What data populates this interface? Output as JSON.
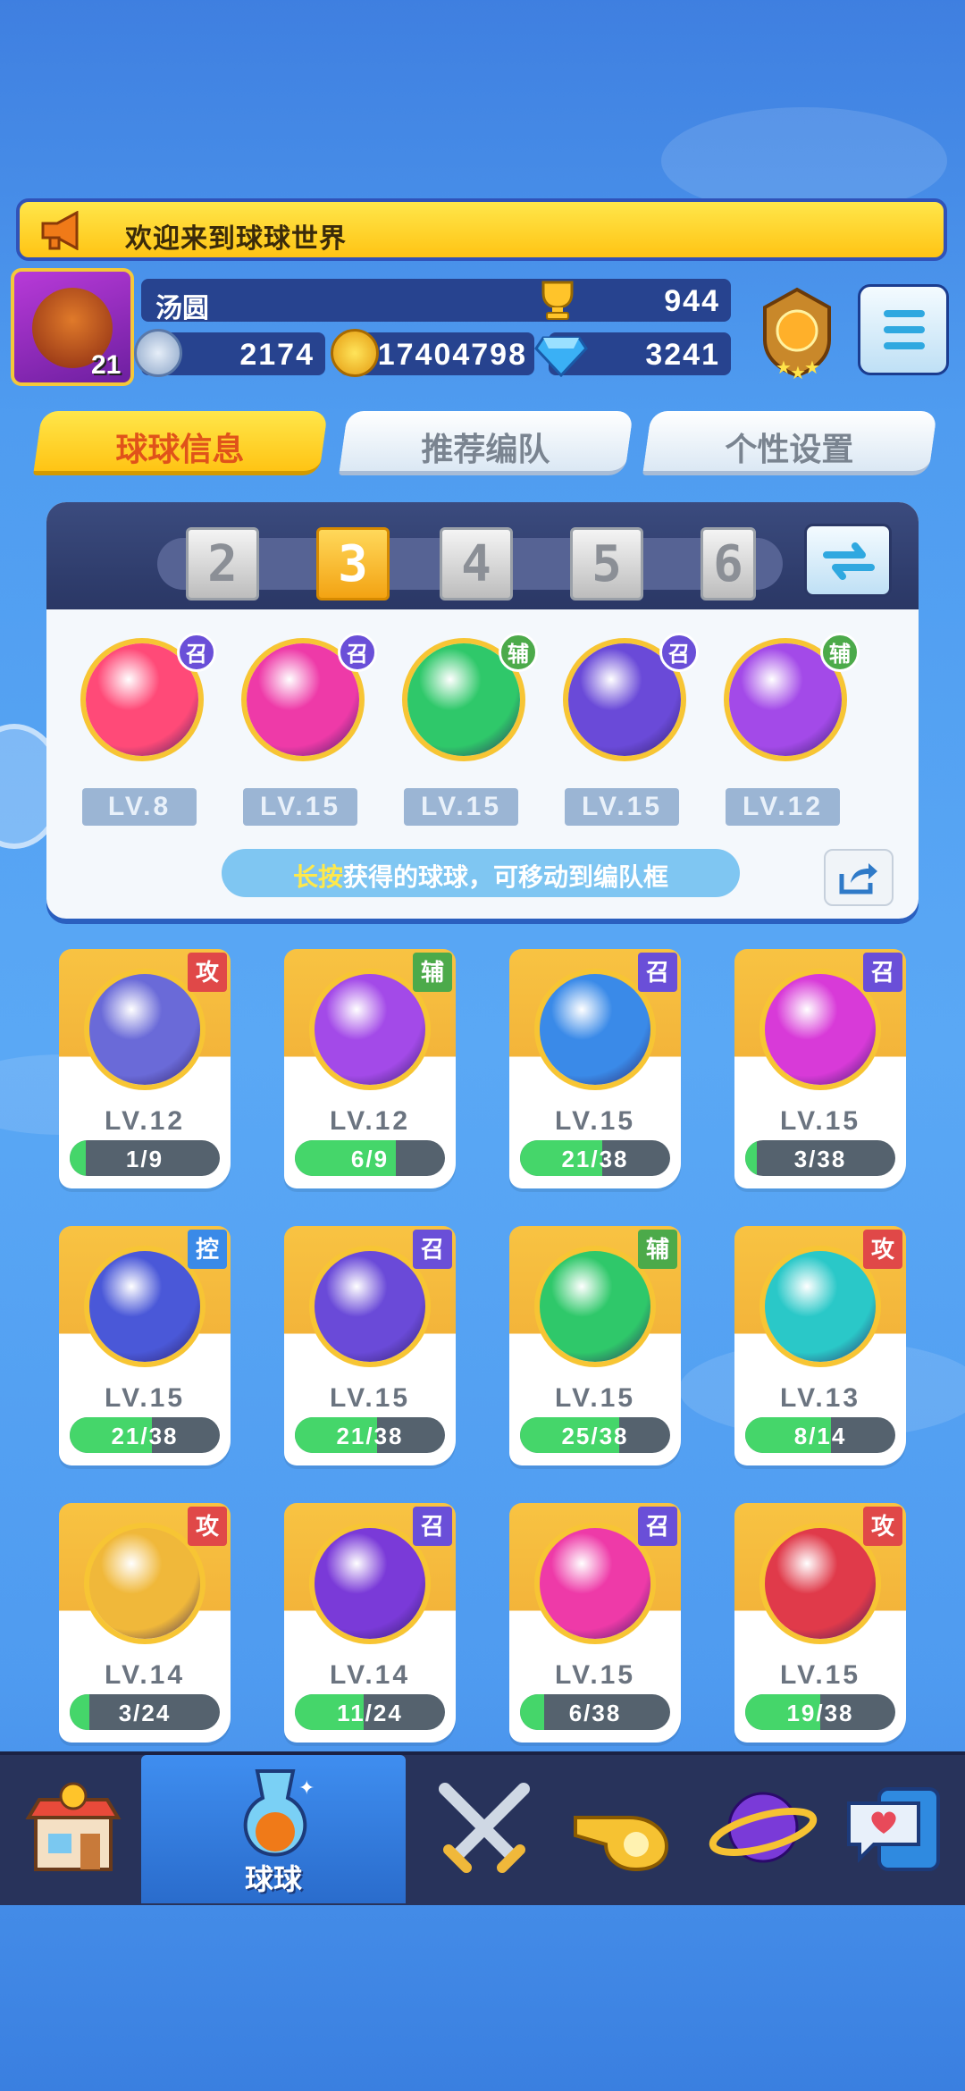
{
  "banner": {
    "text": "欢迎来到球球世界"
  },
  "player": {
    "name": "汤圆",
    "level": "21",
    "trophies": "944",
    "energy": "2174",
    "coins": "17404798",
    "gems": "3241"
  },
  "tabs": [
    {
      "label": "球球信息",
      "active": true
    },
    {
      "label": "推荐编队",
      "active": false
    },
    {
      "label": "个性设置",
      "active": false
    }
  ],
  "team": {
    "slots": [
      "2",
      "3",
      "4",
      "5",
      "6"
    ],
    "active_slot": "3",
    "balls": [
      {
        "level": "LV.8",
        "tag": "召",
        "color": "#ff4a78",
        "tag_color": "#6a4fd8"
      },
      {
        "level": "LV.15",
        "tag": "召",
        "color": "#ee3aa8",
        "tag_color": "#6a4fd8"
      },
      {
        "level": "LV.15",
        "tag": "辅",
        "color": "#2fc86a",
        "tag_color": "#4caa4a"
      },
      {
        "level": "LV.15",
        "tag": "召",
        "color": "#6a4ad8",
        "tag_color": "#6a4fd8"
      },
      {
        "level": "LV.12",
        "tag": "辅",
        "color": "#a34ae8",
        "tag_color": "#4caa4a"
      }
    ],
    "hint_key": "长按",
    "hint_rest": "获得的球球，可移动到编队框"
  },
  "cards": [
    {
      "level": "LV.12",
      "progress": "1/9",
      "fill": 0.11,
      "tag": "攻",
      "tag_color": "#e04848",
      "color": "#6a6ad8"
    },
    {
      "level": "LV.12",
      "progress": "6/9",
      "fill": 0.67,
      "tag": "辅",
      "tag_color": "#4caa4a",
      "color": "#a34ae8"
    },
    {
      "level": "LV.15",
      "progress": "21/38",
      "fill": 0.55,
      "tag": "召",
      "tag_color": "#6a4fd8",
      "color": "#3a8ae8"
    },
    {
      "level": "LV.15",
      "progress": "3/38",
      "fill": 0.08,
      "tag": "召",
      "tag_color": "#6a4fd8",
      "color": "#d83ad8"
    },
    {
      "level": "LV.15",
      "progress": "21/38",
      "fill": 0.55,
      "tag": "控",
      "tag_color": "#3a8ae8",
      "color": "#4a58d8"
    },
    {
      "level": "LV.15",
      "progress": "21/38",
      "fill": 0.55,
      "tag": "召",
      "tag_color": "#6a4fd8",
      "color": "#6a4ad8"
    },
    {
      "level": "LV.15",
      "progress": "25/38",
      "fill": 0.66,
      "tag": "辅",
      "tag_color": "#4caa4a",
      "color": "#2fc86a"
    },
    {
      "level": "LV.13",
      "progress": "8/14",
      "fill": 0.57,
      "tag": "攻",
      "tag_color": "#e04848",
      "color": "#2ac8c8"
    },
    {
      "level": "LV.14",
      "progress": "3/24",
      "fill": 0.13,
      "tag": "攻",
      "tag_color": "#e04848",
      "color": "#f0b83a"
    },
    {
      "level": "LV.14",
      "progress": "11/24",
      "fill": 0.46,
      "tag": "召",
      "tag_color": "#6a4fd8",
      "color": "#7a3ad8"
    },
    {
      "level": "LV.15",
      "progress": "6/38",
      "fill": 0.16,
      "tag": "召",
      "tag_color": "#6a4fd8",
      "color": "#ee3aa8"
    },
    {
      "level": "LV.15",
      "progress": "19/38",
      "fill": 0.5,
      "tag": "攻",
      "tag_color": "#e04848",
      "color": "#e03a4a"
    }
  ],
  "nav": {
    "active_label": "球球"
  }
}
